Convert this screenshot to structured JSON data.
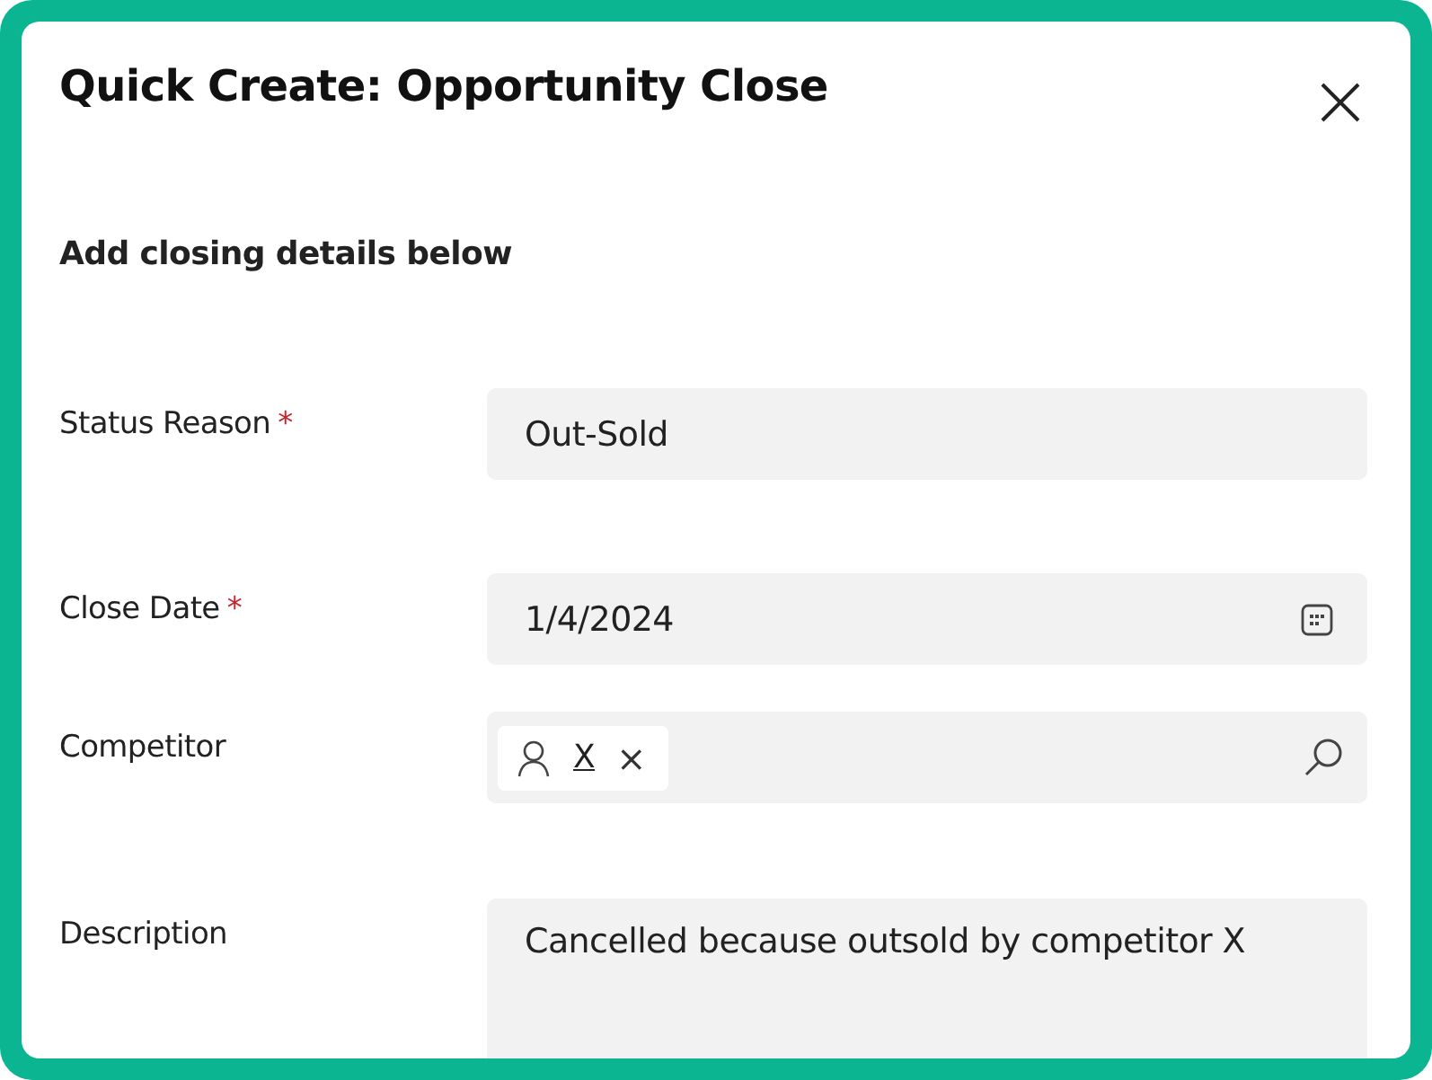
{
  "dialog": {
    "title": "Quick Create: Opportunity Close",
    "subtitle": "Add closing details below"
  },
  "fields": [
    {
      "kind": "text",
      "label": "Status Reason",
      "required_mark": "*",
      "value": "Out-Sold"
    },
    {
      "kind": "date",
      "label": "Close Date",
      "required_mark": "*",
      "value": "1/4/2024"
    },
    {
      "kind": "lookup",
      "label": "Competitor",
      "tag": {
        "text": "X",
        "remove": "×"
      }
    },
    {
      "kind": "multiline",
      "label": "Description",
      "value": "Cancelled because outsold by competitor X"
    }
  ]
}
